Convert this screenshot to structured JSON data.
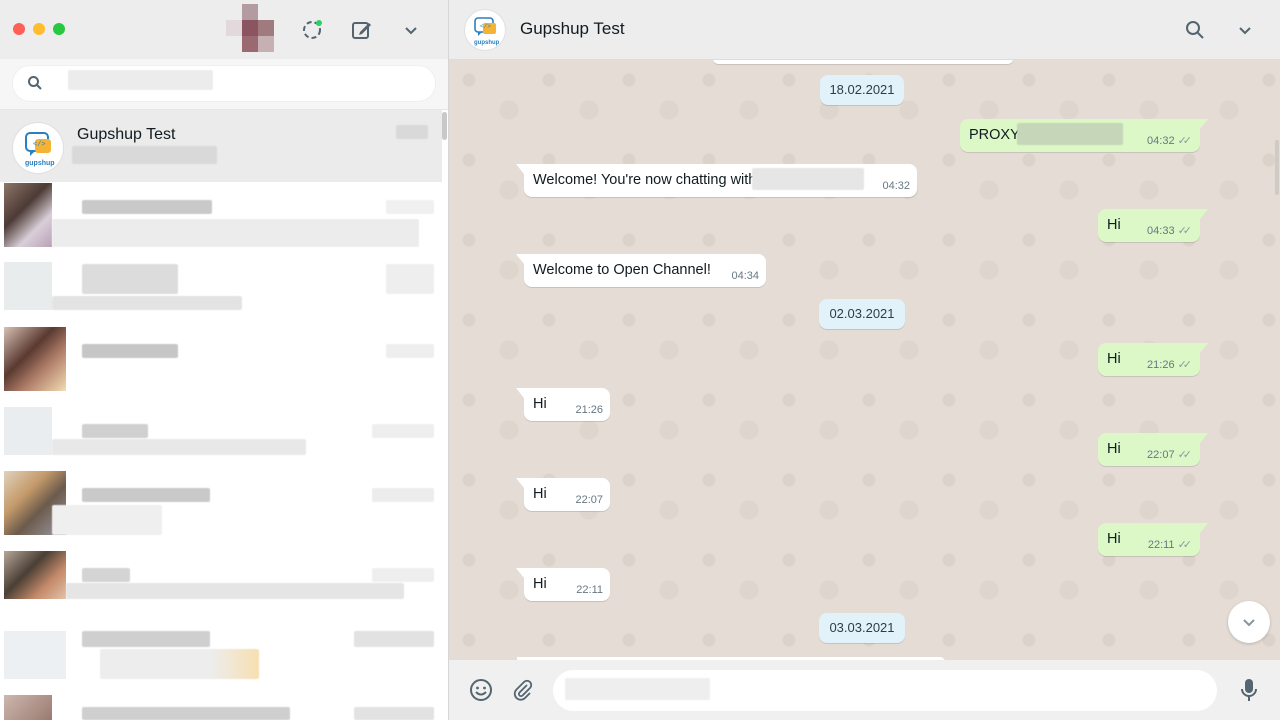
{
  "sidebar": {
    "chats": [
      {
        "name": "Gupshup Test",
        "active": true
      }
    ]
  },
  "conversation": {
    "title": "Gupshup Test",
    "avatar_text": "gupshup",
    "messages": [
      {
        "type": "date",
        "text": "18.02.2021"
      },
      {
        "type": "out",
        "text": "PROXY",
        "time": "04:32"
      },
      {
        "type": "in",
        "text": "Welcome! You're now chatting with",
        "time": "04:32"
      },
      {
        "type": "out",
        "text": "Hi",
        "time": "04:33"
      },
      {
        "type": "in",
        "text": "Welcome to Open Channel!",
        "time": "04:34"
      },
      {
        "type": "date",
        "text": "02.03.2021"
      },
      {
        "type": "out",
        "text": "Hi",
        "time": "21:26"
      },
      {
        "type": "in",
        "text": "Hi",
        "time": "21:26"
      },
      {
        "type": "out",
        "text": "Hi",
        "time": "22:07"
      },
      {
        "type": "in",
        "text": "Hi",
        "time": "22:07"
      },
      {
        "type": "out",
        "text": "Hi",
        "time": "22:11"
      },
      {
        "type": "in",
        "text": "Hi",
        "time": "22:11"
      },
      {
        "type": "date",
        "text": "03.03.2021"
      }
    ]
  },
  "icons": {
    "new_chat": "compose-icon",
    "status": "status-icon",
    "menu": "chevron-down-icon",
    "search": "search-icon",
    "emoji": "emoji-icon",
    "attach": "paperclip-icon",
    "mic": "microphone-icon"
  },
  "colors": {
    "outgoing_bubble": "#dcf8c6",
    "incoming_bubble": "#ffffff",
    "date_pill": "#e1f2fb",
    "chat_background": "#e5ddd5",
    "status_dot": "#25d366"
  }
}
